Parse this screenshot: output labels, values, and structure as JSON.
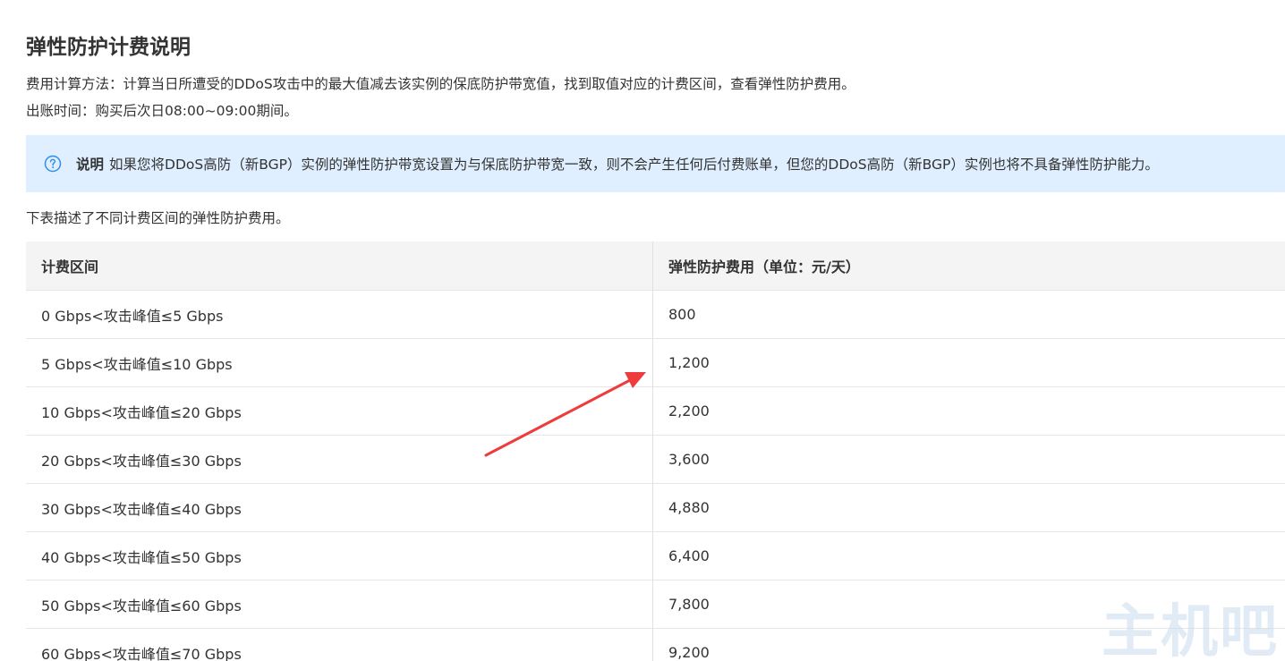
{
  "title": "弹性防护计费说明",
  "intro": {
    "method": "费用计算方法：计算当日所遭受的DDoS攻击中的最大值减去该实例的保底防护带宽值，找到取值对应的计费区间，查看弹性防护费用。",
    "billing_time": "出账时间：购买后次日08:00~09:00期间。"
  },
  "note": {
    "icon": "question-circle-icon",
    "label": "说明",
    "text": "如果您将DDoS高防（新BGP）实例的弹性防护带宽设置为与保底防护带宽一致，则不会产生任何后付费账单，但您的DDoS高防（新BGP）实例也将不具备弹性防护能力。"
  },
  "table_intro": "下表描述了不同计费区间的弹性防护费用。",
  "table": {
    "headers": [
      "计费区间",
      "弹性防护费用（单位：元/天）"
    ],
    "rows": [
      [
        "0 Gbps<攻击峰值≤5 Gbps",
        "800"
      ],
      [
        "5 Gbps<攻击峰值≤10 Gbps",
        "1,200"
      ],
      [
        "10 Gbps<攻击峰值≤20 Gbps",
        "2,200"
      ],
      [
        "20 Gbps<攻击峰值≤30 Gbps",
        "3,600"
      ],
      [
        "30 Gbps<攻击峰值≤40 Gbps",
        "4,880"
      ],
      [
        "40 Gbps<攻击峰值≤50 Gbps",
        "6,400"
      ],
      [
        "50 Gbps<攻击峰值≤60 Gbps",
        "7,800"
      ],
      [
        "60 Gbps<攻击峰值≤70 Gbps",
        "9,200"
      ]
    ]
  },
  "watermark": "主机吧",
  "colors": {
    "note_background": "#dfefff",
    "note_icon": "#2f8fe8",
    "annotation_arrow": "#ee3b3b",
    "table_header_background": "#f4f4f4"
  }
}
